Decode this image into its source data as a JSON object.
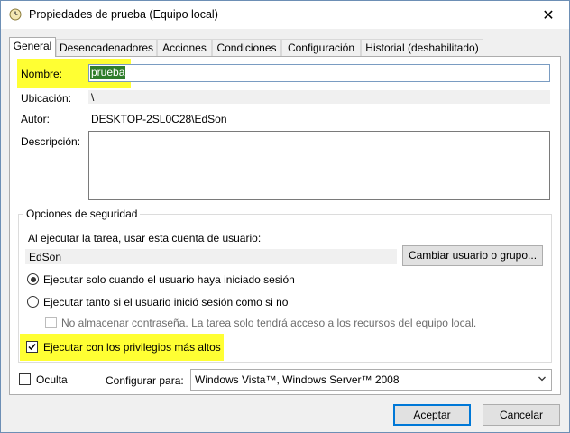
{
  "window": {
    "title": "Propiedades de prueba (Equipo local)",
    "close_glyph": "✕",
    "icon": "task-clock-icon"
  },
  "tabs": [
    {
      "label": "General",
      "active": true
    },
    {
      "label": "Desencadenadores",
      "active": false
    },
    {
      "label": "Acciones",
      "active": false
    },
    {
      "label": "Condiciones",
      "active": false
    },
    {
      "label": "Configuración",
      "active": false
    },
    {
      "label": "Historial (deshabilitado)",
      "active": false
    }
  ],
  "general": {
    "name_label": "Nombre:",
    "name_value": "prueba",
    "location_label": "Ubicación:",
    "location_value": "\\",
    "author_label": "Autor:",
    "author_value": "DESKTOP-2SL0C28\\EdSon",
    "description_label": "Descripción:",
    "description_value": ""
  },
  "security": {
    "group_title": "Opciones de seguridad",
    "run_as_text": "Al ejecutar la tarea, usar esta cuenta de usuario:",
    "user_account": "EdSon",
    "change_user_button": "Cambiar usuario o grupo...",
    "radio_logged_on": "Ejecutar solo cuando el usuario haya iniciado sesión",
    "radio_logged_on_selected": true,
    "radio_whether": "Ejecutar tanto si el usuario inició sesión como si no",
    "radio_whether_selected": false,
    "no_store_password": "No almacenar contraseña. La tarea solo tendrá acceso a los recursos del equipo local.",
    "no_store_password_checked": false,
    "highest_privileges": "Ejecutar con los privilegios más altos",
    "highest_privileges_checked": true
  },
  "bottom": {
    "hidden_label": "Oculta",
    "hidden_checked": false,
    "configure_for_label": "Configurar para:",
    "configure_for_value": "Windows Vista™, Windows Server™ 2008"
  },
  "buttons": {
    "accept": "Aceptar",
    "cancel": "Cancelar"
  },
  "colors": {
    "highlight": "#ffff33",
    "selection": "#2f7d2b",
    "accent": "#0078d7"
  }
}
